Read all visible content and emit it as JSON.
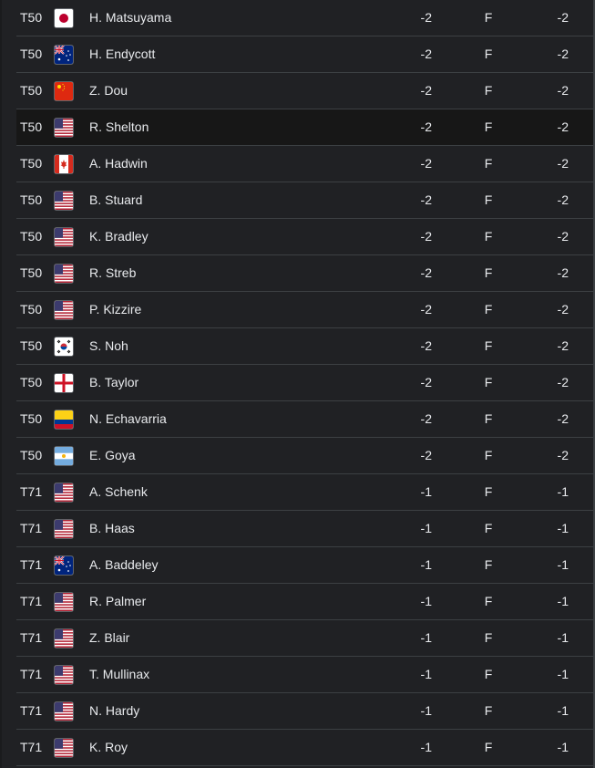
{
  "leaderboard": {
    "rows": [
      {
        "pos": "T50",
        "flag": "japan-flag",
        "name": "H. Matsuyama",
        "today": "-2",
        "thru": "F",
        "total": "-2"
      },
      {
        "pos": "T50",
        "flag": "australia-flag",
        "name": "H. Endycott",
        "today": "-2",
        "thru": "F",
        "total": "-2"
      },
      {
        "pos": "T50",
        "flag": "china-flag",
        "name": "Z. Dou",
        "today": "-2",
        "thru": "F",
        "total": "-2"
      },
      {
        "pos": "T50",
        "flag": "usa-flag",
        "name": "R. Shelton",
        "today": "-2",
        "thru": "F",
        "total": "-2",
        "highlighted": true
      },
      {
        "pos": "T50",
        "flag": "canada-flag",
        "name": "A. Hadwin",
        "today": "-2",
        "thru": "F",
        "total": "-2"
      },
      {
        "pos": "T50",
        "flag": "usa-flag",
        "name": "B. Stuard",
        "today": "-2",
        "thru": "F",
        "total": "-2"
      },
      {
        "pos": "T50",
        "flag": "usa-flag",
        "name": "K. Bradley",
        "today": "-2",
        "thru": "F",
        "total": "-2"
      },
      {
        "pos": "T50",
        "flag": "usa-flag",
        "name": "R. Streb",
        "today": "-2",
        "thru": "F",
        "total": "-2"
      },
      {
        "pos": "T50",
        "flag": "usa-flag",
        "name": "P. Kizzire",
        "today": "-2",
        "thru": "F",
        "total": "-2"
      },
      {
        "pos": "T50",
        "flag": "south-korea-flag",
        "name": "S. Noh",
        "today": "-2",
        "thru": "F",
        "total": "-2"
      },
      {
        "pos": "T50",
        "flag": "england-flag",
        "name": "B. Taylor",
        "today": "-2",
        "thru": "F",
        "total": "-2"
      },
      {
        "pos": "T50",
        "flag": "colombia-flag",
        "name": "N. Echavarria",
        "today": "-2",
        "thru": "F",
        "total": "-2"
      },
      {
        "pos": "T50",
        "flag": "argentina-flag",
        "name": "E. Goya",
        "today": "-2",
        "thru": "F",
        "total": "-2"
      },
      {
        "pos": "T71",
        "flag": "usa-flag",
        "name": "A. Schenk",
        "today": "-1",
        "thru": "F",
        "total": "-1"
      },
      {
        "pos": "T71",
        "flag": "usa-flag",
        "name": "B. Haas",
        "today": "-1",
        "thru": "F",
        "total": "-1"
      },
      {
        "pos": "T71",
        "flag": "australia-flag",
        "name": "A. Baddeley",
        "today": "-1",
        "thru": "F",
        "total": "-1"
      },
      {
        "pos": "T71",
        "flag": "usa-flag",
        "name": "R. Palmer",
        "today": "-1",
        "thru": "F",
        "total": "-1"
      },
      {
        "pos": "T71",
        "flag": "usa-flag",
        "name": "Z. Blair",
        "today": "-1",
        "thru": "F",
        "total": "-1"
      },
      {
        "pos": "T71",
        "flag": "usa-flag",
        "name": "T. Mullinax",
        "today": "-1",
        "thru": "F",
        "total": "-1"
      },
      {
        "pos": "T71",
        "flag": "usa-flag",
        "name": "N. Hardy",
        "today": "-1",
        "thru": "F",
        "total": "-1"
      },
      {
        "pos": "T71",
        "flag": "usa-flag",
        "name": "K. Roy",
        "today": "-1",
        "thru": "F",
        "total": "-1"
      }
    ]
  }
}
